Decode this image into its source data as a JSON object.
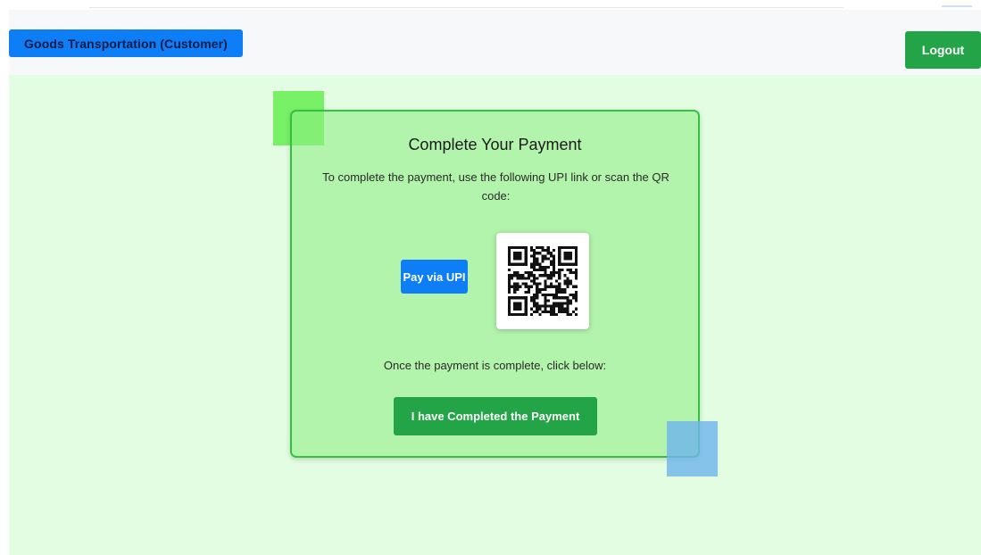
{
  "navbar": {
    "brand_label": "Goods Transportation (Customer)",
    "logout_label": "Logout"
  },
  "payment": {
    "title": "Complete Your Payment",
    "description": "To complete the payment, use the following UPI link or scan the QR code:",
    "pay_upi_label": "Pay via UPI",
    "qr_icon": "qr-code",
    "completion_note": "Once the payment is complete, click below:",
    "complete_button_label": "I have Completed the Payment"
  },
  "colors": {
    "primary_blue": "#0d7ef5",
    "success_green": "#22a447",
    "page_background": "#e2fde2",
    "card_border": "#34c141"
  }
}
